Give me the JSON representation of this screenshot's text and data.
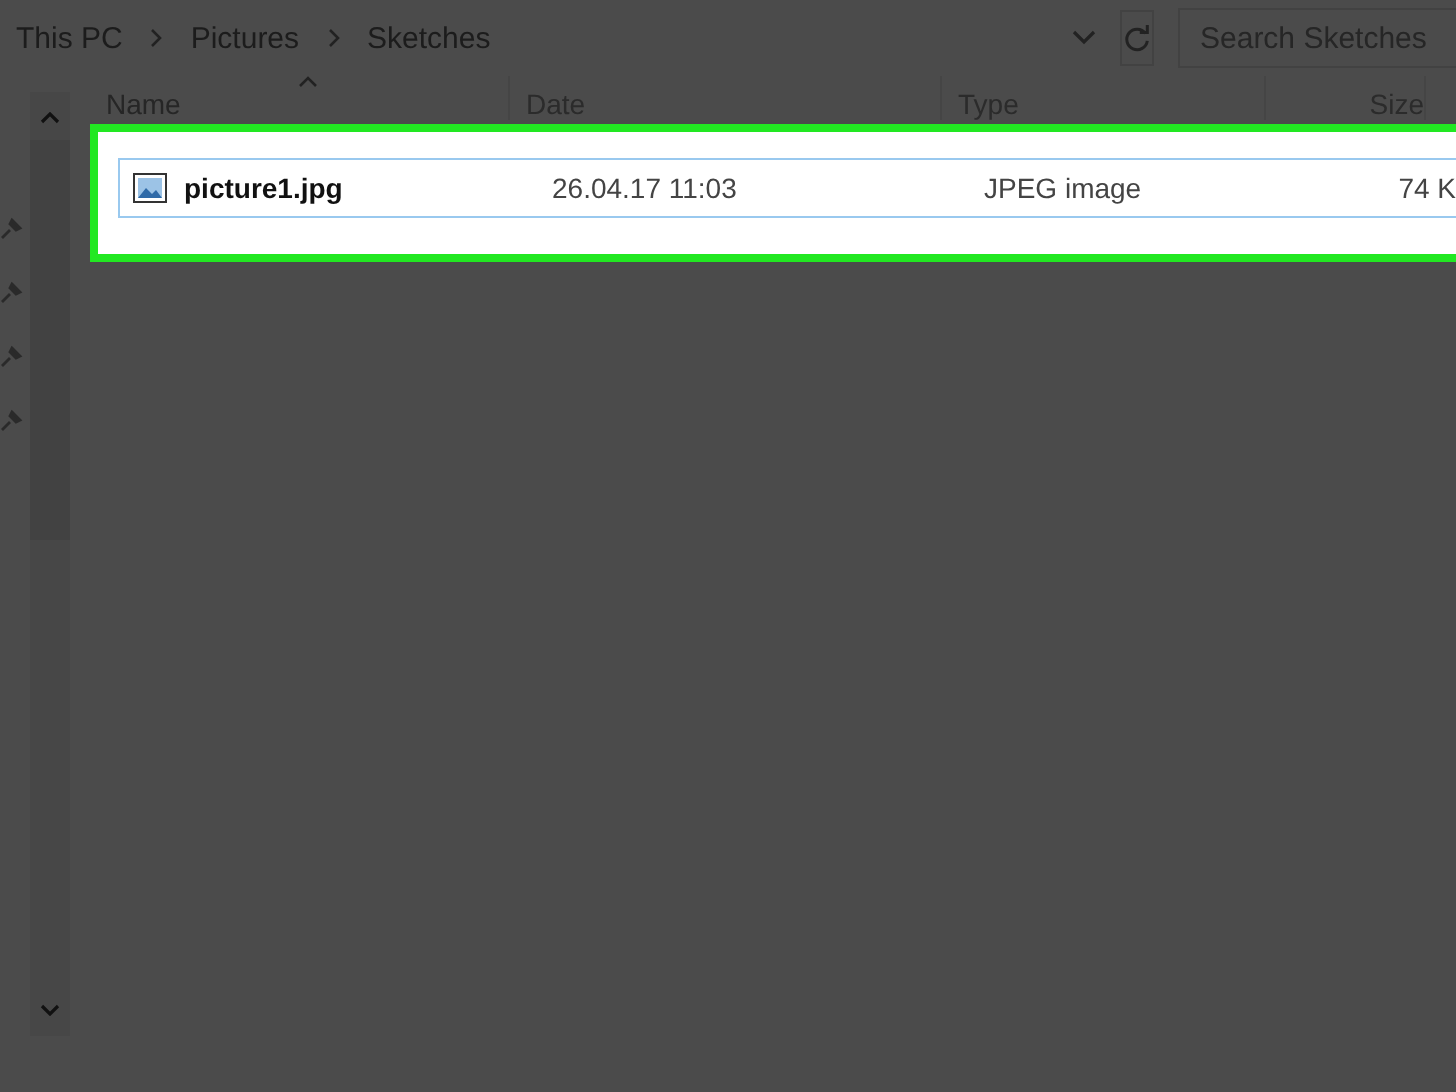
{
  "breadcrumbs": [
    "This PC",
    "Pictures",
    "Sketches"
  ],
  "search": {
    "placeholder": "Search Sketches"
  },
  "columns": [
    {
      "label": "Name",
      "sorted": true
    },
    {
      "label": "Date",
      "sorted": false
    },
    {
      "label": "Type",
      "sorted": false
    },
    {
      "label": "Size",
      "sorted": false
    }
  ],
  "files": [
    {
      "name": "picture1.jpg",
      "date": "26.04.17 11:03",
      "type": "JPEG image",
      "size": "74 K",
      "selected": true
    }
  ]
}
